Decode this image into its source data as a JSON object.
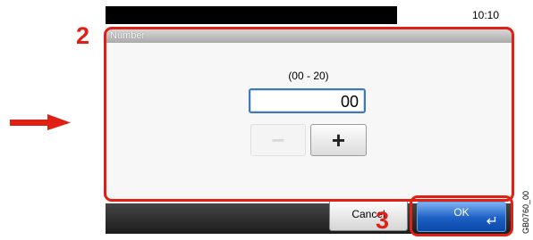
{
  "status": {
    "time": "10:10"
  },
  "dialog": {
    "title": "Number",
    "range_label": "(00 - 20)",
    "value": "00",
    "minus_label": "−",
    "plus_label": "+"
  },
  "footer": {
    "cancel_label": "Cancel",
    "ok_label": "OK",
    "ok_icon": "enter-icon"
  },
  "callouts": {
    "step_2": "2",
    "step_3": "3",
    "color": "#e02015"
  },
  "figure_code": "GB0760_00",
  "colors": {
    "accent_blue": "#1b5fc4",
    "field_border": "#3f78b8"
  }
}
